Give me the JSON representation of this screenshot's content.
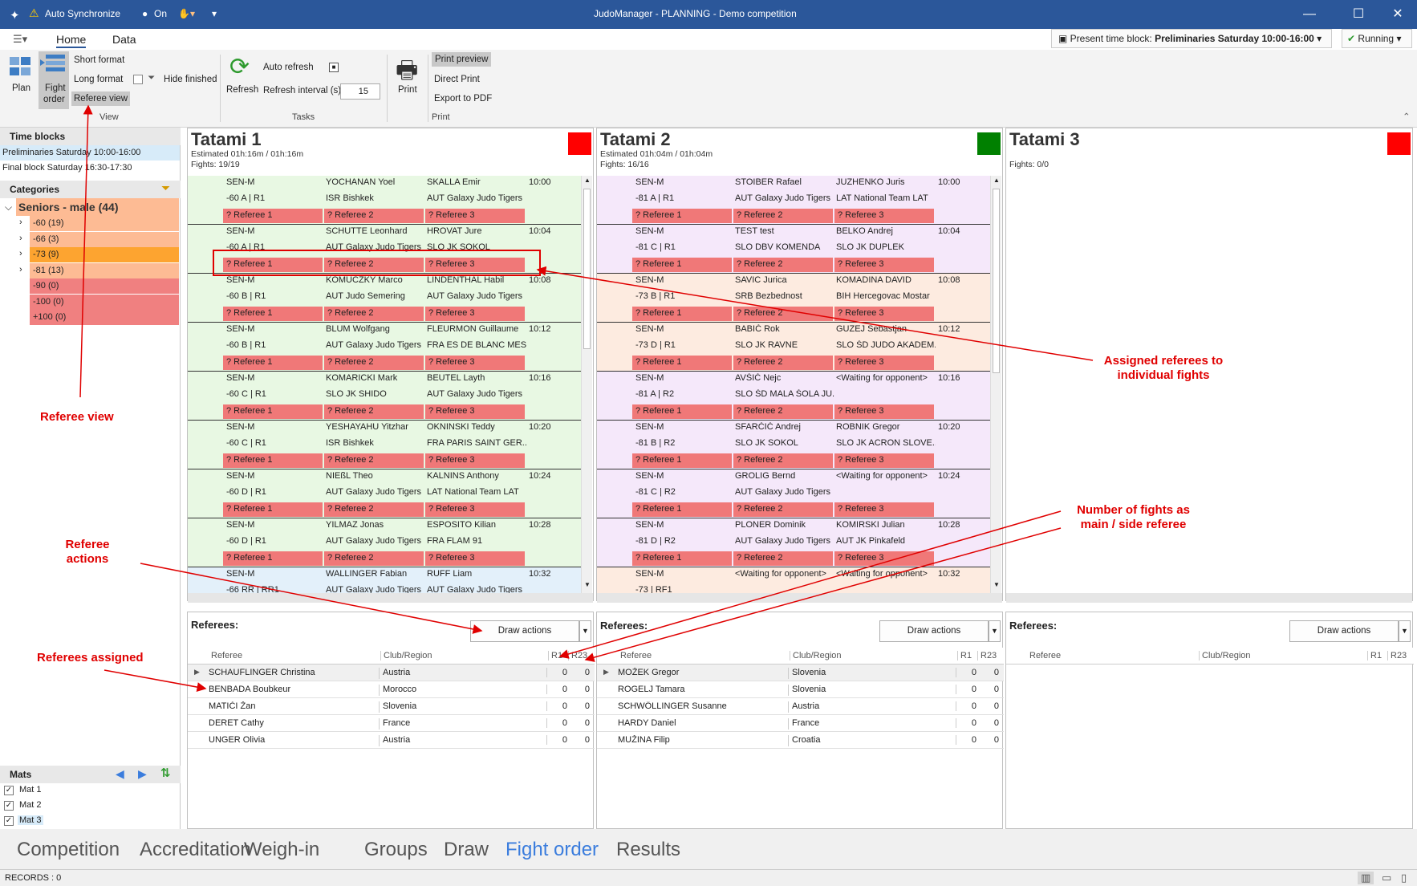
{
  "window": {
    "title": "JudoManager - PLANNING - Demo competition",
    "auto_sync": "Auto Synchronize",
    "sync_state": "On"
  },
  "ribbon": {
    "tabs": [
      "Home",
      "Data"
    ],
    "time_block_prefix": "Present time block:",
    "time_block_value": "Preliminaries  Saturday 10:00-16:00",
    "running": "Running",
    "plan": "Plan",
    "fight_order_1": "Fight",
    "fight_order_2": "order",
    "short_format": "Short format",
    "long_format": "Long format",
    "referee_view": "Referee view",
    "hide_finished": "Hide finished",
    "refresh": "Refresh",
    "auto_refresh": "Auto refresh",
    "refresh_interval": "Refresh interval (s)",
    "refresh_value": "15",
    "print": "Print",
    "print_preview": "Print preview",
    "direct_print": "Direct Print",
    "export_pdf": "Export to PDF",
    "groups": {
      "view": "View",
      "tasks": "Tasks",
      "print": "Print"
    }
  },
  "left": {
    "time_blocks_title": "Time blocks",
    "time_blocks": [
      "Preliminaries  Saturday 10:00-16:00",
      "Final block  Saturday 16:30-17:30"
    ],
    "categories_title": "Categories",
    "group": "Seniors - male (44)",
    "cats": [
      {
        "label": "-60 (19)",
        "color": "#fdbb94",
        "exp": true
      },
      {
        "label": "-66 (3)",
        "color": "#fdbb94",
        "exp": true
      },
      {
        "label": "-73 (9)",
        "color": "#fda430",
        "exp": true
      },
      {
        "label": "-81 (13)",
        "color": "#fdbb94",
        "exp": true
      },
      {
        "label": "-90 (0)",
        "color": "#f08080",
        "exp": false
      },
      {
        "label": "-100 (0)",
        "color": "#f08080",
        "exp": false
      },
      {
        "label": "+100 (0)",
        "color": "#f08080",
        "exp": false
      }
    ],
    "mats_title": "Mats",
    "mats": [
      "Mat 1",
      "Mat 2",
      "Mat 3"
    ]
  },
  "tatamis": [
    {
      "name": "Tatami 1",
      "est": "Estimated 01h:16m / 01h:16m",
      "fights": "Fights: 19/19",
      "flag": "#ff0000",
      "rows": [
        {
          "bg": "#e8f8e3",
          "c": "SEN-M",
          "w": "-60 A | R1",
          "p1": "YOCHANAN Yoel",
          "c1": "ISR Bishkek",
          "p2": "SKALLA Emir",
          "c2": "AUT Galaxy Judo Tigers",
          "t": "10:00"
        },
        {
          "bg": "#e8f8e3",
          "c": "SEN-M",
          "w": "-60 A | R1",
          "p1": "SCHUTTE Leonhard",
          "c1": "AUT Galaxy Judo Tigers",
          "p2": "HROVAT Jure",
          "c2": "SLO JK SOKOL",
          "t": "10:04"
        },
        {
          "bg": "#e8f8e3",
          "c": "SEN-M",
          "w": "-60 B | R1",
          "p1": "KOMUCZKY Marco",
          "c1": "AUT Judo Semering",
          "p2": "LINDENTHAL Habil",
          "c2": "AUT Galaxy Judo Tigers",
          "t": "10:08"
        },
        {
          "bg": "#e8f8e3",
          "c": "SEN-M",
          "w": "-60 B | R1",
          "p1": "BLUM Wolfgang",
          "c1": "AUT Galaxy Judo Tigers",
          "p2": "FLEURMON Guillaume",
          "c2": "FRA ES DE BLANC MES...",
          "t": "10:12"
        },
        {
          "bg": "#e8f8e3",
          "c": "SEN-M",
          "w": "-60 C | R1",
          "p1": "KOMARICKI Mark",
          "c1": "SLO JK SHIDO",
          "p2": "BEUTEL Layth",
          "c2": "AUT Galaxy Judo Tigers",
          "t": "10:16"
        },
        {
          "bg": "#e8f8e3",
          "c": "SEN-M",
          "w": "-60 C | R1",
          "p1": "YESHAYAHU Yitzhar",
          "c1": "ISR Bishkek",
          "p2": "OKNINSKI Teddy",
          "c2": "FRA PARIS SAINT GER...",
          "t": "10:20"
        },
        {
          "bg": "#e8f8e3",
          "c": "SEN-M",
          "w": "-60 D | R1",
          "p1": "NIEßL Theo",
          "c1": "AUT Galaxy Judo Tigers",
          "p2": "KALNINS Anthony",
          "c2": "LAT National Team LAT",
          "t": "10:24"
        },
        {
          "bg": "#e8f8e3",
          "c": "SEN-M",
          "w": "-60 D | R1",
          "p1": "YILMAZ Jonas",
          "c1": "AUT Galaxy Judo Tigers",
          "p2": "ESPOSITO Kilian",
          "c2": "FRA FLAM 91",
          "t": "10:28"
        },
        {
          "bg": "#e3f0fa",
          "c": "SEN-M",
          "w": "-66 RR | RR1",
          "p1": "WALLINGER Fabian",
          "c1": "AUT Galaxy Judo Tigers",
          "p2": "RUFF Liam",
          "c2": "AUT Galaxy Judo Tigers",
          "t": "10:32"
        }
      ]
    },
    {
      "name": "Tatami 2",
      "est": "Estimated 01h:04m / 01h:04m",
      "fights": "Fights: 16/16",
      "flag": "#008000",
      "rows": [
        {
          "bg": "#f5e8fa",
          "c": "SEN-M",
          "w": "-81 A | R1",
          "p1": "STOIBER Rafael",
          "c1": "AUT Galaxy Judo Tigers",
          "p2": "JUZHENKO Juris",
          "c2": "LAT National Team LAT",
          "t": "10:00"
        },
        {
          "bg": "#f5e8fa",
          "c": "SEN-M",
          "w": "-81 C | R1",
          "p1": "TEST test",
          "c1": "SLO DBV KOMENDA",
          "p2": "BELKO Andrej",
          "c2": "SLO JK DUPLEK",
          "t": "10:04"
        },
        {
          "bg": "#fdebe0",
          "c": "SEN-M",
          "w": "-73 B | R1",
          "p1": "SAVIC Jurica",
          "c1": "SRB Bezbednost",
          "p2": "KOMADINA DAVID",
          "c2": "BIH Hercegovac Mostar",
          "t": "10:08"
        },
        {
          "bg": "#fdebe0",
          "c": "SEN-M",
          "w": "-73 D | R1",
          "p1": "BABIČ Rok",
          "c1": "SLO JK RAVNE",
          "p2": "GUZEJ Sebastjan",
          "c2": "SLO ŠD JUDO AKADEM...",
          "t": "10:12"
        },
        {
          "bg": "#f5e8fa",
          "c": "SEN-M",
          "w": "-81 A | R2",
          "p1": "AVŠIČ Nejc",
          "c1": "SLO ŠD MALA ŠOLA JU...",
          "p2": "<Waiting for opponent>",
          "c2": "",
          "t": "10:16"
        },
        {
          "bg": "#f5e8fa",
          "c": "SEN-M",
          "w": "-81 B | R2",
          "p1": "SFARČIČ Andrej",
          "c1": "SLO JK SOKOL",
          "p2": "ROBNIK Gregor",
          "c2": "SLO JK ACRON SLOVE...",
          "t": "10:20"
        },
        {
          "bg": "#f5e8fa",
          "c": "SEN-M",
          "w": "-81 C | R2",
          "p1": "GROLIG Bernd",
          "c1": "AUT Galaxy Judo Tigers",
          "p2": "<Waiting for opponent>",
          "c2": "",
          "t": "10:24"
        },
        {
          "bg": "#f5e8fa",
          "c": "SEN-M",
          "w": "-81 D | R2",
          "p1": "PLONER Dominik",
          "c1": "AUT Galaxy Judo Tigers",
          "p2": "KOMIRSKI Julian",
          "c2": "AUT JK Pinkafeld",
          "t": "10:28"
        },
        {
          "bg": "#fdebe0",
          "c": "SEN-M",
          "w": "-73 | RF1",
          "p1": "<Waiting for opponent>",
          "c1": "",
          "p2": "<Waiting for opponent>",
          "c2": "",
          "t": "10:32"
        }
      ]
    },
    {
      "name": "Tatami 3",
      "est": "",
      "fights": "Fights: 0/0",
      "flag": "#ff0000",
      "rows": []
    }
  ],
  "ref_labels": [
    "? Referee 1",
    "? Referee 2",
    "? Referee 3"
  ],
  "referees": {
    "label": "Referees:",
    "draw": "Draw actions",
    "cols": [
      "Referee",
      "Club/Region",
      "R1",
      "R23"
    ],
    "panels": [
      [
        {
          "n": "SCHAUFLINGER Christina",
          "c": "Austria",
          "r1": "0",
          "r23": "0"
        },
        {
          "n": "BENBADA Boubkeur",
          "c": "Morocco",
          "r1": "0",
          "r23": "0"
        },
        {
          "n": "MATIČI Žan",
          "c": "Slovenia",
          "r1": "0",
          "r23": "0"
        },
        {
          "n": "DERET Cathy",
          "c": "France",
          "r1": "0",
          "r23": "0"
        },
        {
          "n": "UNGER Olivia",
          "c": "Austria",
          "r1": "0",
          "r23": "0"
        }
      ],
      [
        {
          "n": "MOŽEK Gregor",
          "c": "Slovenia",
          "r1": "0",
          "r23": "0"
        },
        {
          "n": "ROGELJ Tamara",
          "c": "Slovenia",
          "r1": "0",
          "r23": "0"
        },
        {
          "n": "SCHWÖLLINGER Susanne",
          "c": "Austria",
          "r1": "0",
          "r23": "0"
        },
        {
          "n": "HARDY Daniel",
          "c": "France",
          "r1": "0",
          "r23": "0"
        },
        {
          "n": "MUŽINA Filip",
          "c": "Croatia",
          "r1": "0",
          "r23": "0"
        }
      ],
      []
    ]
  },
  "nav": [
    "Competition",
    "Accreditation",
    "Weigh-in",
    "Groups",
    "Draw",
    "Fight order",
    "Results"
  ],
  "nav_active": "Fight order",
  "status": "RECORDS : 0",
  "annotations": {
    "referee_view": "Referee view",
    "assigned_1": "Assigned referees to",
    "assigned_2": "individual fights",
    "actions_1": "Referee",
    "actions_2": "actions",
    "assigned_refs": "Referees assigned",
    "numfights_1": "Number of fights as",
    "numfights_2": "main / side referee"
  }
}
